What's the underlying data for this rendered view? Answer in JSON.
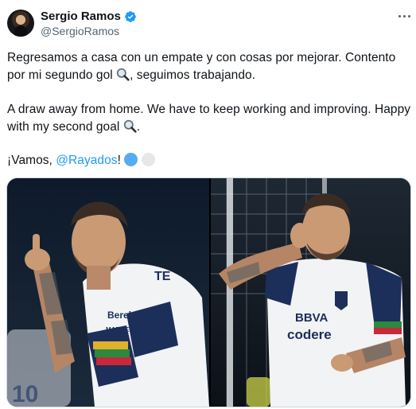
{
  "author": {
    "name": "Sergio Ramos",
    "handle": "@SergioRamos",
    "verified": true,
    "avatar_icon": "profile-photo"
  },
  "menu_icon": "more-horizontal-icon",
  "tweet": {
    "spanish_line1": "Regresamos a casa con un empate y con cosas por mejorar. Contento",
    "spanish_line2_before": "por mi segundo gol",
    "spanish_line2_after": ", seguimos trabajando.",
    "english_line1": "A draw away from home. We have to keep working and improving. Happy",
    "english_line2_before": "with my second goal",
    "english_line2_after": ".",
    "closing_before": "¡Vamos, ",
    "closing_mention": "@Rayados",
    "closing_after": "!",
    "emoji_goal": "magnifying-glass-emoji",
    "emoji_team": [
      "blue-circle-emoji",
      "white-circle-emoji"
    ]
  },
  "media": {
    "photos": [
      {
        "name": "ramos-pointing-photo",
        "jersey_text": [
          "Berel",
          "MARKEST",
          "TE"
        ],
        "back_number": "10"
      },
      {
        "name": "ramos-ear-celebration-photo",
        "jersey_text": [
          "BBVA",
          "codere"
        ]
      }
    ]
  },
  "colors": {
    "accent": "#1d9bf0",
    "text": "#0f1419",
    "muted": "#536471",
    "kit_white": "#f1f3f5",
    "kit_navy": "#1c2e5a"
  }
}
